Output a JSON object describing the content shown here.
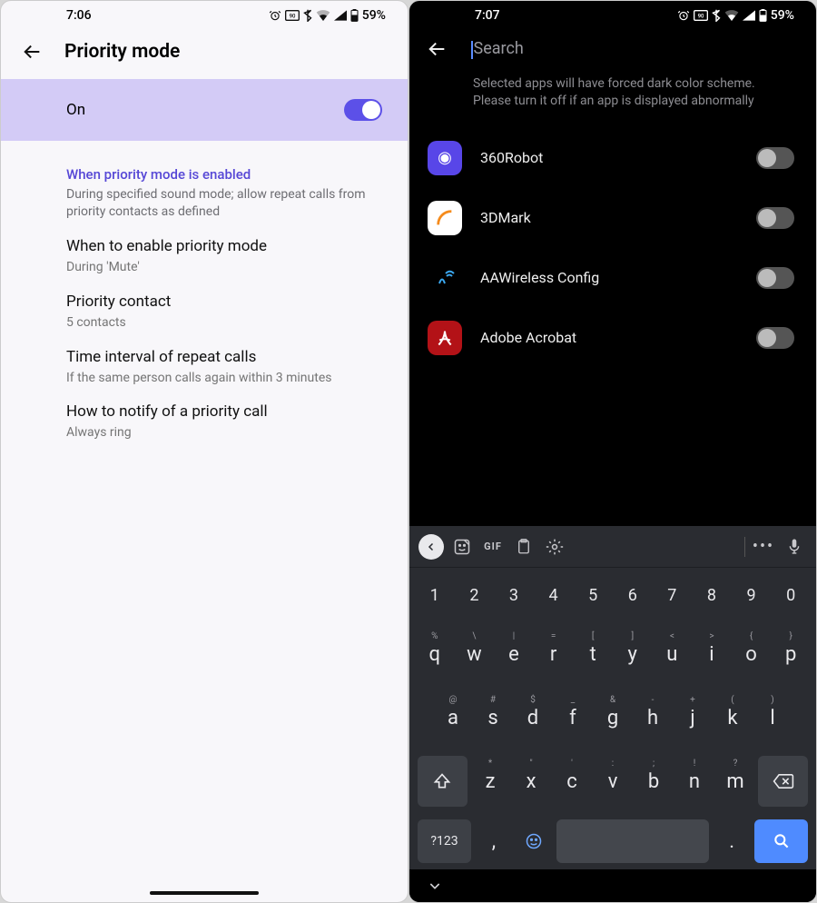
{
  "left": {
    "status": {
      "time": "7:06",
      "battery": "59%"
    },
    "title": "Priority mode",
    "toggle_row": {
      "label": "On",
      "on": true
    },
    "section_header": {
      "title": "When priority mode is enabled",
      "subtitle": "During specified sound mode; allow repeat calls from priority contacts as defined"
    },
    "items": [
      {
        "title": "When to enable priority mode",
        "subtitle": "During 'Mute'"
      },
      {
        "title": "Priority contact",
        "subtitle": "5 contacts"
      },
      {
        "title": "Time interval of repeat calls",
        "subtitle": "If the same person calls again within 3 minutes"
      },
      {
        "title": "How to notify of a priority call",
        "subtitle": "Always ring"
      }
    ]
  },
  "right": {
    "status": {
      "time": "7:07",
      "battery": "59%"
    },
    "search_placeholder": "Search",
    "info": "Selected apps will have forced dark color scheme. Please turn it off if an app is displayed abnormally",
    "apps": [
      {
        "name": "360Robot",
        "on": false
      },
      {
        "name": "3DMark",
        "on": false
      },
      {
        "name": "AAWireless Config",
        "on": false
      },
      {
        "name": "Adobe Acrobat",
        "on": false
      }
    ],
    "keyboard": {
      "toolbar_gif": "GIF",
      "row_nums": [
        "1",
        "2",
        "3",
        "4",
        "5",
        "6",
        "7",
        "8",
        "9",
        "0"
      ],
      "row1": {
        "keys": [
          "q",
          "w",
          "e",
          "r",
          "t",
          "y",
          "u",
          "i",
          "o",
          "p"
        ],
        "hints": [
          "%",
          "\\",
          "|",
          "=",
          "[",
          "]",
          "<",
          ">",
          "{",
          "}"
        ]
      },
      "row2": {
        "keys": [
          "a",
          "s",
          "d",
          "f",
          "g",
          "h",
          "j",
          "k",
          "l"
        ],
        "hints": [
          "@",
          "#",
          "$",
          "_",
          "&",
          "-",
          "+",
          "(",
          ")"
        ]
      },
      "row3": {
        "keys": [
          "z",
          "x",
          "c",
          "v",
          "b",
          "n",
          "m"
        ],
        "hints": [
          "*",
          "\"",
          "'",
          ":",
          ";",
          "!",
          "?"
        ]
      },
      "sym_key": "?123",
      "comma": ",",
      "period": "."
    }
  }
}
